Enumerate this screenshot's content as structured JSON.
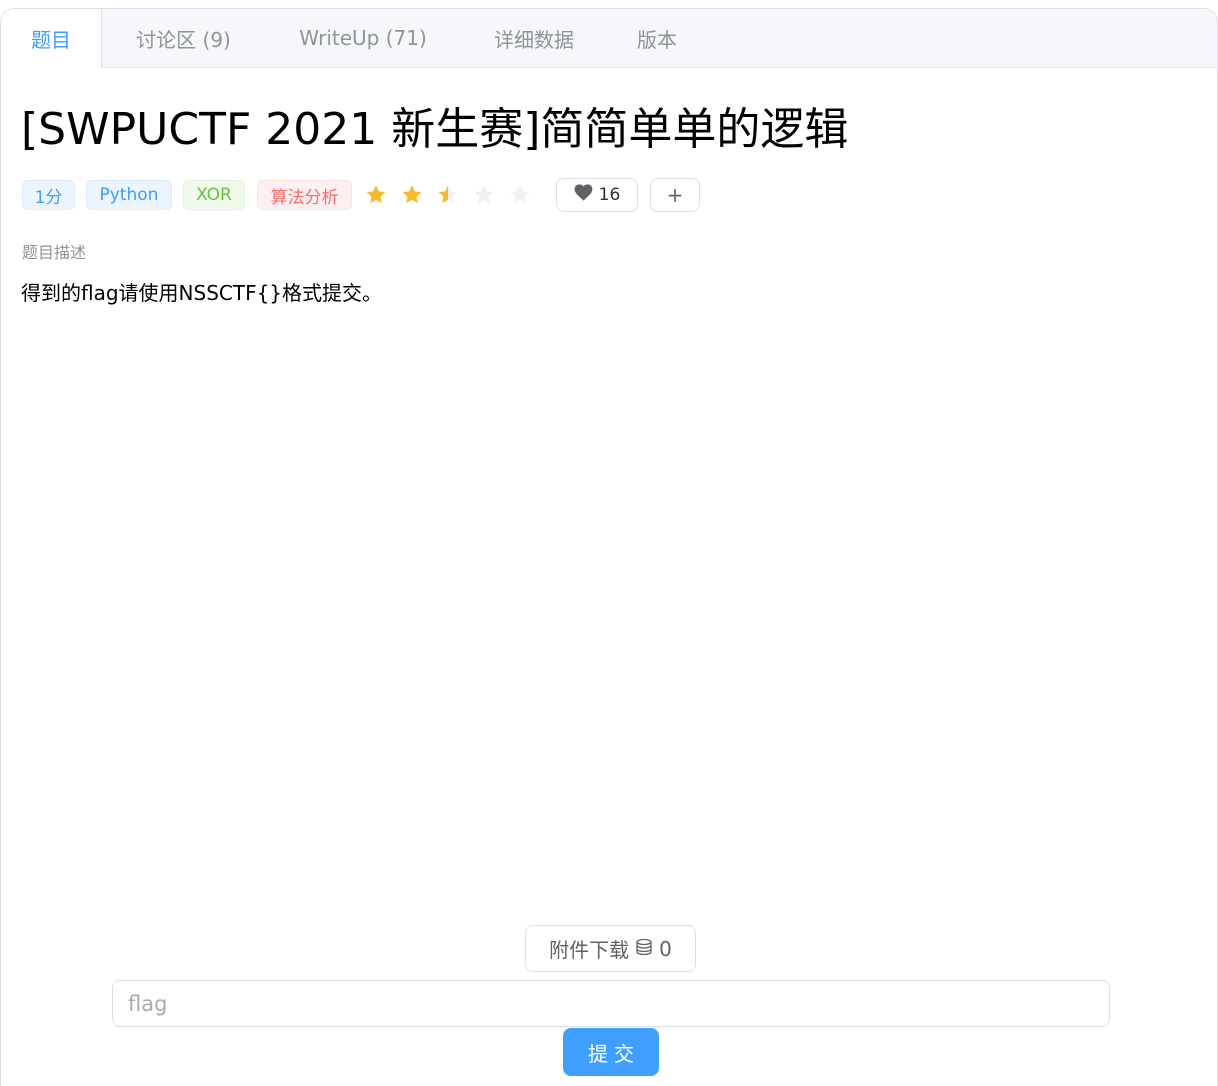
{
  "tabs": [
    {
      "label": "题目"
    },
    {
      "label": "讨论区 (9)"
    },
    {
      "label": "WriteUp (71)"
    },
    {
      "label": "详细数据"
    },
    {
      "label": "版本"
    }
  ],
  "challenge": {
    "title": "[SWPUCTF 2021 新生赛]简简单单的逻辑",
    "tags": {
      "score": "1分",
      "language": "Python",
      "technique": "XOR",
      "category": "算法分析"
    },
    "difficulty_rating": 2.5,
    "difficulty_max": 5,
    "likes": "16",
    "add_label": "+",
    "description_label": "题目描述",
    "description": "得到的flag请使用NSSCTF{}格式提交。"
  },
  "attachment": {
    "label": "附件下载",
    "count": "0",
    "icon": "database-icon"
  },
  "flag_input": {
    "placeholder": "flag",
    "value": ""
  },
  "submit_label": "提交",
  "colors": {
    "primary": "#409eff",
    "success": "#67c23a",
    "danger": "#f56c6c",
    "star": "#f7ba2a",
    "star_empty": "#eef0f4"
  }
}
